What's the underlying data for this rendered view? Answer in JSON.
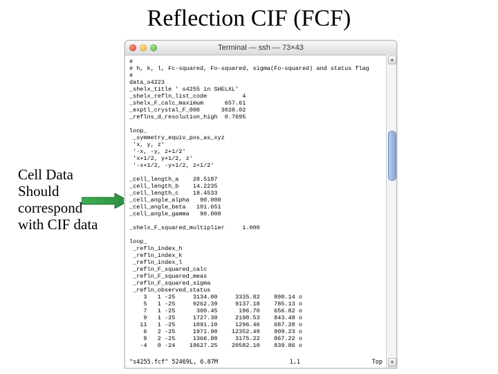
{
  "title": "Reflection CIF (FCF)",
  "annotation": {
    "l1": "Cell Data",
    "l2": "Should",
    "l3": "correspond",
    "l4": "with CIF data"
  },
  "window": {
    "title": "Terminal — ssh — 73×43"
  },
  "terminal": {
    "body": "#\n# h, k, l, Fc-squared, Fo-squared, sigma(Fo-squared) and status flag\n#\ndata_s4223\n_shelx_title ' s4255 in SHELXL'\n_shelx_refln_list_code          4\n_shelx_F_calc_maximum      657.61\n_exptl_crystal_F_000      3028.02\n_reflns_d_resolution_high  0.7695\n\nloop_\n _symmetry_equiv_pos_as_xyz\n 'x, y, z'\n '-x, -y, z+1/2'\n 'x+1/2, y+1/2, z'\n '-x+1/2, -y+1/2, z+1/2'\n\n_cell_length_a    28.5187\n_cell_length_b    14.2235\n_cell_length_c    19.4533\n_cell_angle_alpha   90.000\n_cell_angle_beta   101.651\n_cell_angle_gamma   90.000\n\n_shelx_F_squared_multiplier     1.000\n\nloop_\n _refln_index_h\n _refln_index_k\n _refln_index_l\n _refln_F_squared_calc\n _refln_F_squared_meas\n _refln_F_squared_sigma\n _refln_observed_status\n    3   1 -25     3134.00     3335.82    898.14 o\n    5   1 -25     9262.39     9137.18    785.13 o\n    7   1 -25      300.45      196.70    656.82 o\n    9   1 -25     1727.30     2198.53    843.48 o\n   11   1 -25     1091.10     1296.46    687.28 o\n    6   2 -25     1971.90    12352.49    909.23 o\n    8   2 -25     1366.88     3175.22    867.22 o\n   -4   0 -24    19627.25    20582.10    839.86 o"
  },
  "statusbar": {
    "left": "\"s4255.fcf\" 52469L, 6.87M",
    "mid": "1,1",
    "right": "Top"
  }
}
